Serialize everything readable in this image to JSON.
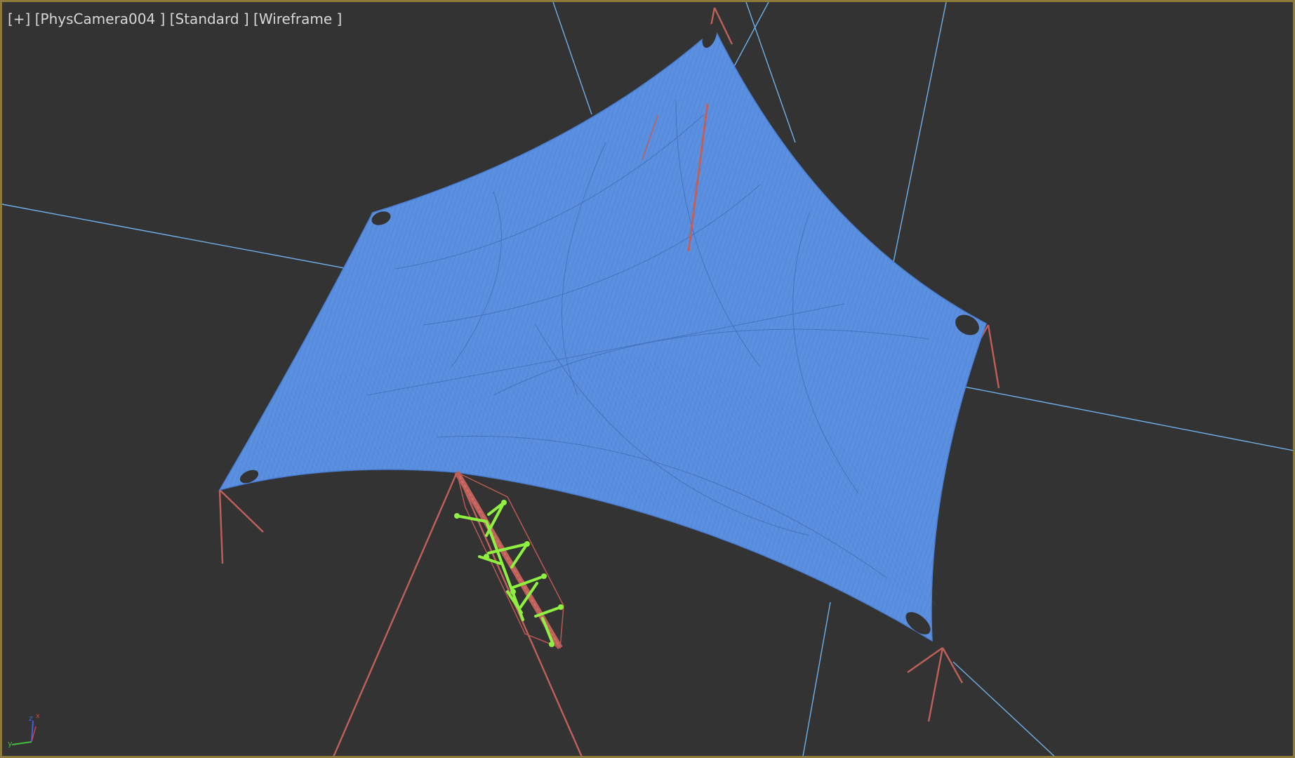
{
  "viewport": {
    "menu_label": "[+]",
    "camera_label": "[PhysCamera004 ]",
    "shading_label": "[Standard ]",
    "display_label": "[Wireframe ]",
    "border_color": "#8e7a3a",
    "background_color": "#333333"
  },
  "scene": {
    "membrane_color": "#5b8fe0",
    "mesh_line_color": "#3a6ab8",
    "guide_line_color": "#6fb0ea",
    "mast_color": "#c0605a",
    "selected_color": "#8ef040"
  },
  "axis_gizmo": {
    "x_label": "x",
    "y_label": "y",
    "z_label": "z",
    "x_color": "#d04040",
    "y_color": "#40c040",
    "z_color": "#4060e0"
  }
}
